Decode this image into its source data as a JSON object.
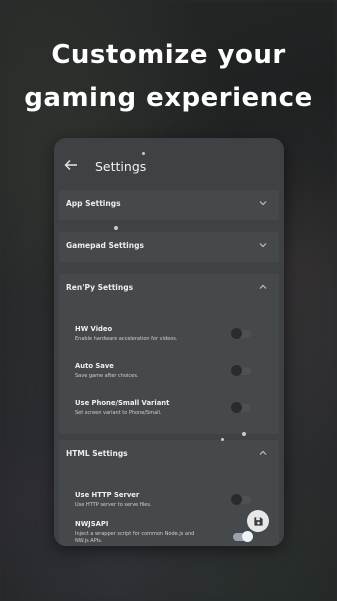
{
  "headline": {
    "line1": "Customize your",
    "line2": "gaming experience"
  },
  "appbar": {
    "title": "Settings",
    "back_icon": "arrow-left-icon"
  },
  "sections": {
    "app": {
      "title": "App Settings",
      "expanded": false
    },
    "gamepad": {
      "title": "Gamepad Settings",
      "expanded": false
    },
    "renpy": {
      "title": "Ren'Py Settings",
      "expanded": true,
      "rows": [
        {
          "title": "HW Video",
          "subtitle": "Enable hardware acceleration for videos.",
          "on": false
        },
        {
          "title": "Auto Save",
          "subtitle": "Save game after choices.",
          "on": false
        },
        {
          "title": "Use Phone/Small Variant",
          "subtitle": "Set screen variant to Phone/Small.",
          "on": false
        }
      ]
    },
    "html": {
      "title": "HTML Settings",
      "expanded": true,
      "rows": [
        {
          "title": "Use HTTP Server",
          "subtitle": "Use HTTP server to serve files.",
          "on": false
        },
        {
          "title": "NWJSAPI",
          "subtitle": "Inject a wrapper script for common Node.js and",
          "subtitle2": "NW.js APIs.",
          "on": true
        }
      ]
    }
  },
  "fab": {
    "icon": "save-icon"
  },
  "colors": {
    "panel": "#3f4245",
    "section": "#46494c",
    "text": "#f0f0f0",
    "fab": "#e8e8e8"
  }
}
